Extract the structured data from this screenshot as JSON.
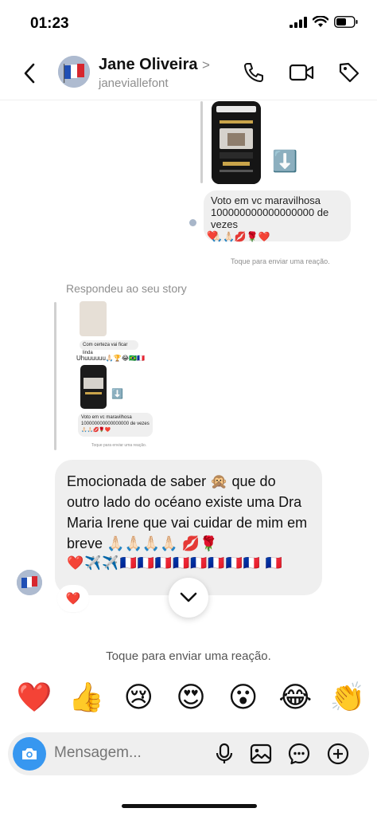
{
  "status": {
    "time": "01:23"
  },
  "header": {
    "name": "Jane Oliveira",
    "chevron": ">",
    "username": "janeviallefont"
  },
  "chat": {
    "sent_vote_text": "Voto em vc maravilhosa 100000000000000000 de vezes",
    "sent_vote_emojis": "🙏🏻🙏🏻💋🌹❤️",
    "sent_reaction": "❤️",
    "react_hint_small": "Toque para enviar uma reação.",
    "story_reply_label": "Respondeu ao seu story",
    "nested": {
      "text1": "Com certeza vai ficar linda",
      "text2": "Uhuuuuuu🙏🏻🏆😂🇧🇷🇫🇷",
      "vote_text": "Voto em vc maravilhosa 100000000000000000 de vezes",
      "vote_emojis": "🙏🏻🙏🏻💋🌹❤️",
      "hint": "Toque para enviar uma reação."
    },
    "main_message": "Emocionada de saber 🙊 que do outro lado do océano existe uma Dra Maria Irene que vai cuidar de mim em breve 🙏🏻🙏🏻🙏🏻🙏🏻 💋🌹",
    "main_emojis": "❤️✈️✈️🇫🇷🇫🇷🇫🇷🇫🇷🇫🇷🇫🇷🇫🇷🇫🇷 🇫🇷",
    "main_reaction": "❤️",
    "react_hint": "Toque para enviar uma reação."
  },
  "quick_reactions": [
    "❤️",
    "👍",
    "😢",
    "😍",
    "😮",
    "😂",
    "👏"
  ],
  "composer": {
    "placeholder": "Mensagem..."
  },
  "colors": {
    "accent": "#3797f0",
    "bubble": "#efefef",
    "hint": "#8e8e8e"
  }
}
